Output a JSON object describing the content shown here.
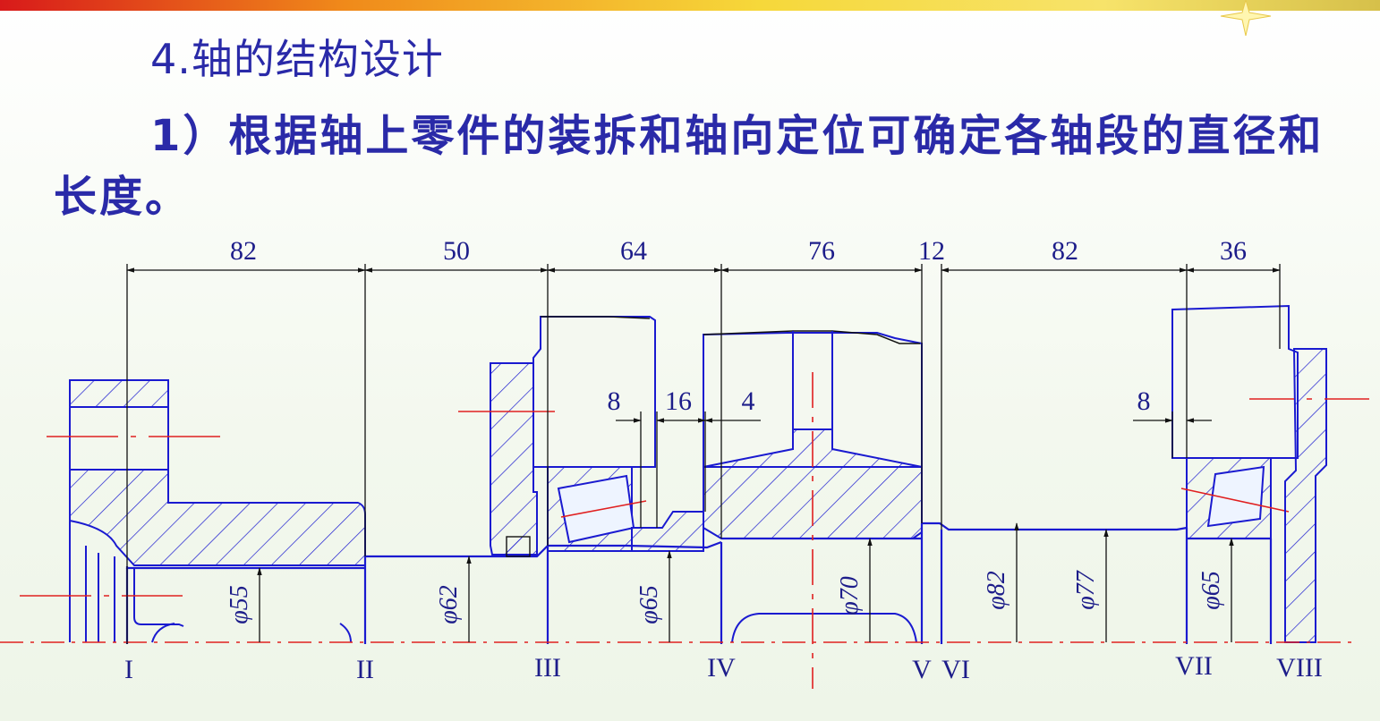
{
  "heading": "4.轴的结构设计",
  "paragraph": "1）根据轴上零件的装拆和轴向定位可确定各轴段的直径和长度。",
  "diagram": {
    "segment_lengths": [
      "82",
      "50",
      "64",
      "76",
      "12",
      "82",
      "36"
    ],
    "local_dims": [
      "8",
      "16",
      "4",
      "8"
    ],
    "diameters": [
      "φ55",
      "φ62",
      "φ65",
      "φ70",
      "φ82",
      "φ77",
      "φ65"
    ],
    "section_labels": [
      "I",
      "II",
      "III",
      "IV",
      "V",
      "VI",
      "VII",
      "VIII"
    ]
  },
  "colors": {
    "text": "#2a2aa8",
    "outline": "#1a1ad0",
    "centerline": "#e02020",
    "dimension": "#1d1d8a"
  }
}
